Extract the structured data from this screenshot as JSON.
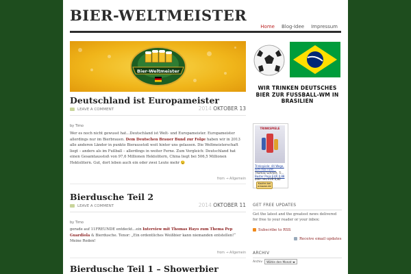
{
  "site": {
    "title": "BIER-WELTMEISTER"
  },
  "nav": {
    "items": [
      "Home",
      "Blog-Idee",
      "Impressum"
    ],
    "active": "Home"
  },
  "banner": {
    "logo_text": "Bier-Weltmeister"
  },
  "posts": [
    {
      "title": "Deutschland ist Europameister",
      "comment_link": "LEAVE A COMMENT",
      "year": "2014",
      "date": "OKTOBER 13",
      "byline": "by Timo",
      "body_1": "Wer es noch nicht gewusst hat...Deutschland ist Welt- und Europameister. Europameister allerdings nur im Bierbrauen. ",
      "link": "Dem Deutschen Brauer Bund zur Folge",
      "body_2": " haben wir in 2013 alle anderen Länder in punkto Bierausstoß weit hinter uns gelassen. Die Weltmeisterschaft liegt – anders als im Fußball – allerdings in weiter Ferne. Zum Vergleich: Deutschland hat einen Gesamtausstoß von 97,6 Millionen Hektolitern, China liegt bei 506,5 Millionen Hektolitern. Gut, dort leben auch ein oder zwei Leute mehr 😉",
      "from": "from → ",
      "category": "Allgemein"
    },
    {
      "title": "Bierdusche Teil 2",
      "comment_link": "LEAVE A COMMENT",
      "year": "2014",
      "date": "OKTOBER 11",
      "byline": "by Timo",
      "body_1": "gerade auf 11FREUNDE entdeckt...ein ",
      "link": "Interview mit Thomas Hayo zum Thema Pep Guardiola",
      "body_2": " & Bierdusche. Tenor: „Ein ordentliches Weißbier kann niemanden entstellen!“ Meine Reden!",
      "from": "from → ",
      "category": "Allgemein"
    },
    {
      "title": "Bierdusche Teil 1 – Showerbier"
    }
  ],
  "sidebar": {
    "slogan": "WIR TRINKEN DEUTSCHES BIER ZUR FUSSBALL-WM IN BRASILIEN",
    "book": {
      "cover_title": "TRINKSPIELE",
      "link_title": "Trinkspiele: 44 Wege, sich mal richt...",
      "author": "Thomas Schmitt, Ti...",
      "price_new": "Neu EUR 6,80",
      "price_best": "Bester Preis EUR 0,88",
      "price_used": "oder neu EUR 6,80",
      "amazon_btn": "Kaufen bei amazon.de"
    },
    "updates": {
      "title": "GET FREE UPDATES",
      "text": "Get the latest and the greatest news delivered for free to your reader or your inbox:",
      "rss": "Subscribe to RSS",
      "email": "Receive email updates"
    },
    "archive": {
      "title": "ARCHIV",
      "label": "Archiv",
      "select": "Wähle den Monat"
    }
  },
  "colors": {
    "background": "#1e4d1e",
    "accent": "#b22222",
    "link": "#8a1c1c",
    "banner_yellow": "#f0b51a"
  }
}
